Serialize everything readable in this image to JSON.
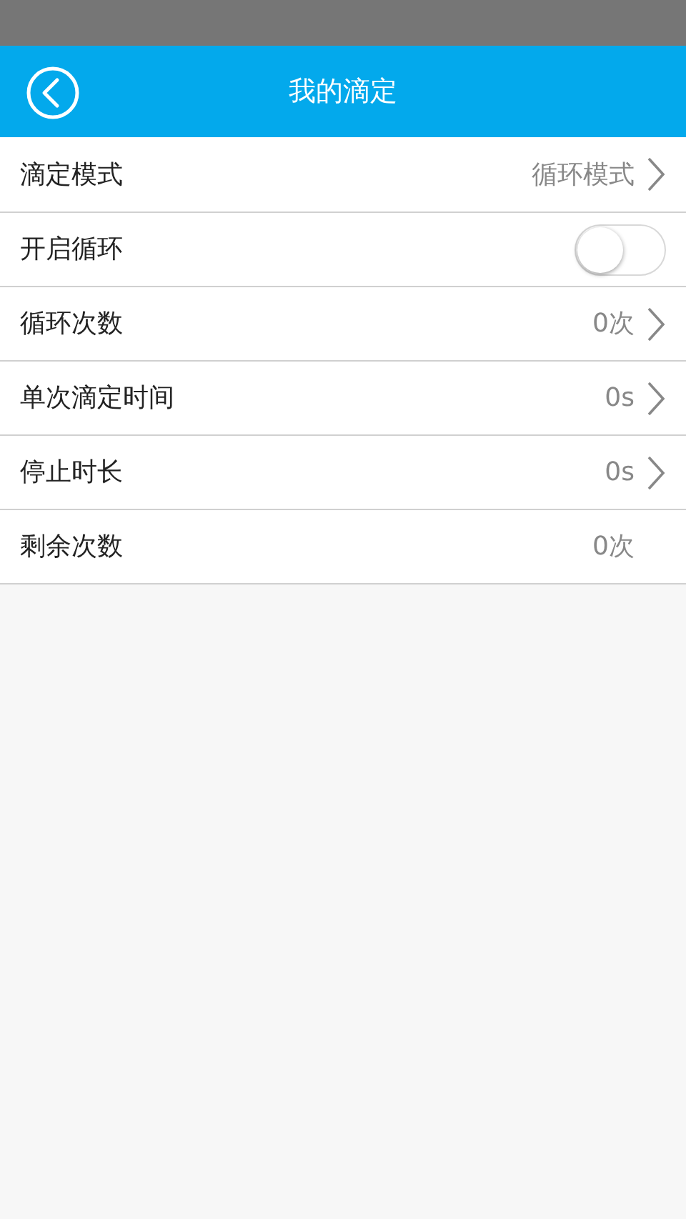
{
  "header": {
    "title": "我的滴定"
  },
  "rows": [
    {
      "kind": "value",
      "label": "滴定模式",
      "value": "循环模式",
      "chevron": true
    },
    {
      "kind": "toggle",
      "label": "开启循环",
      "on": false
    },
    {
      "kind": "value",
      "label": "循环次数",
      "value": "0次",
      "chevron": true
    },
    {
      "kind": "value",
      "label": "单次滴定时间",
      "value": "0s",
      "chevron": true
    },
    {
      "kind": "value",
      "label": "停止时长",
      "value": "0s",
      "chevron": true
    },
    {
      "kind": "value",
      "label": "剩余次数",
      "value": "0次",
      "chevron": false
    }
  ]
}
